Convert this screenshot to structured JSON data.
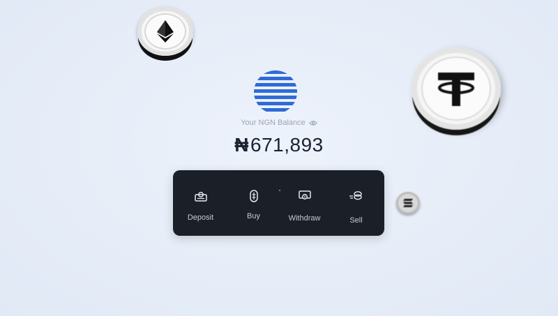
{
  "balance": {
    "label": "Your NGN Balance",
    "currency_symbol": "₦",
    "amount": "671,893",
    "visibility_icon": "eye-icon"
  },
  "logo": {
    "icon": "striped-globe-logo",
    "color": "#2f6bd6"
  },
  "actions": [
    {
      "label": "Deposit",
      "icon": "deposit-icon"
    },
    {
      "label": "Buy",
      "icon": "buy-icon"
    },
    {
      "label": "Withdraw",
      "icon": "withdraw-icon"
    },
    {
      "label": "Sell",
      "icon": "sell-icon"
    }
  ],
  "coins": [
    {
      "icon": "ethereum-coin-icon"
    },
    {
      "icon": "tether-coin-icon"
    },
    {
      "icon": "solana-coin-icon"
    }
  ],
  "colors": {
    "background": "#e6edf8",
    "card": "#1b2028",
    "brand_blue": "#2f6bd6",
    "amount_text": "#1b2230",
    "muted_text": "#9aa4b4"
  }
}
